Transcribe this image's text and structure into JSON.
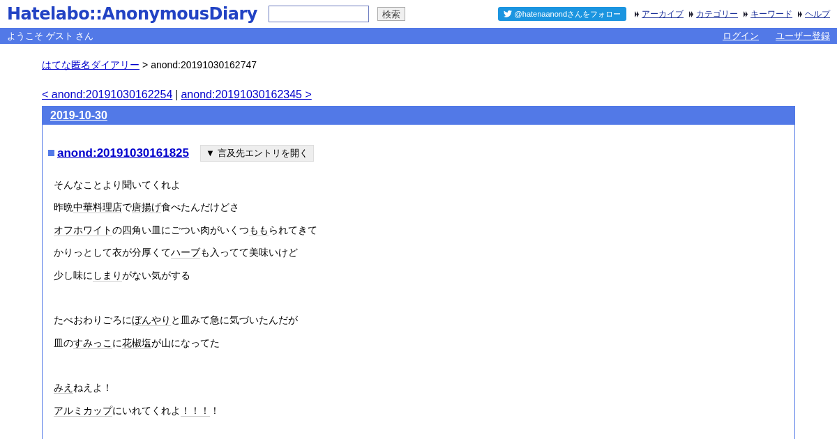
{
  "header": {
    "logo": "Hatelabo::AnonymousDiary",
    "search": {
      "button": "検索"
    },
    "follow_button": "@hatenaanondさんをフォロー",
    "links": [
      "アーカイブ",
      "カテゴリー",
      "キーワード",
      "ヘルプ"
    ]
  },
  "welcome_bar": {
    "greeting": "ようこそ ゲスト さん",
    "links": [
      "ログイン",
      "ユーザー登録"
    ]
  },
  "breadcrumb": {
    "home": "はてな匿名ダイアリー",
    "separator": ">",
    "current": "anond:20191030162747"
  },
  "pager": {
    "prev": "< anond:20191030162254",
    "separator": "|",
    "next": "anond:20191030162345 >"
  },
  "day": {
    "date": "2019-10-30",
    "entry": {
      "title": "anond:20191030161825",
      "refer_button": "▼ 言及先エントリを開く",
      "paragraphs": [
        {
          "space_before": false,
          "segments": [
            {
              "text": "そんなことより聞いてくれよ",
              "keyword": false
            }
          ]
        },
        {
          "space_before": false,
          "segments": [
            {
              "text": "昨晩",
              "keyword": false
            },
            {
              "text": "中華料理店",
              "keyword": true
            },
            {
              "text": "で",
              "keyword": false
            },
            {
              "text": "唐揚げ",
              "keyword": true
            },
            {
              "text": "食べたんだけどさ",
              "keyword": false
            }
          ]
        },
        {
          "space_before": false,
          "segments": [
            {
              "text": "オフホワイト",
              "keyword": true
            },
            {
              "text": "の四角い皿にごつい肉がいくつ",
              "keyword": false
            },
            {
              "text": "もも",
              "keyword": true
            },
            {
              "text": "られてきて",
              "keyword": false
            }
          ]
        },
        {
          "space_before": false,
          "segments": [
            {
              "text": "かりっとして衣が分厚くて",
              "keyword": false
            },
            {
              "text": "ハーブ",
              "keyword": true
            },
            {
              "text": "も入ってて美味いけど",
              "keyword": false
            }
          ]
        },
        {
          "space_before": false,
          "segments": [
            {
              "text": "少し味に",
              "keyword": false
            },
            {
              "text": "しまり",
              "keyword": true
            },
            {
              "text": "がない気がする",
              "keyword": false
            }
          ]
        },
        {
          "space_before": true,
          "segments": [
            {
              "text": "たべおわりごろに",
              "keyword": false
            },
            {
              "text": "ぼんやり",
              "keyword": true
            },
            {
              "text": "と皿みて急に気づいたんだが",
              "keyword": false
            }
          ]
        },
        {
          "space_before": false,
          "segments": [
            {
              "text": "皿の",
              "keyword": false
            },
            {
              "text": "すみっこ",
              "keyword": true
            },
            {
              "text": "に",
              "keyword": false
            },
            {
              "text": "花椒塩",
              "keyword": true
            },
            {
              "text": "が山になってた",
              "keyword": false
            }
          ]
        },
        {
          "space_before": true,
          "segments": [
            {
              "text": "みえ",
              "keyword": true
            },
            {
              "text": "ねえよ！",
              "keyword": false
            }
          ]
        },
        {
          "space_before": false,
          "segments": [
            {
              "text": "アルミカップ",
              "keyword": true
            },
            {
              "text": "にいれてくれよ",
              "keyword": false
            },
            {
              "text": "！！！",
              "keyword": true
            },
            {
              "text": "！",
              "keyword": false
            }
          ]
        }
      ]
    }
  }
}
